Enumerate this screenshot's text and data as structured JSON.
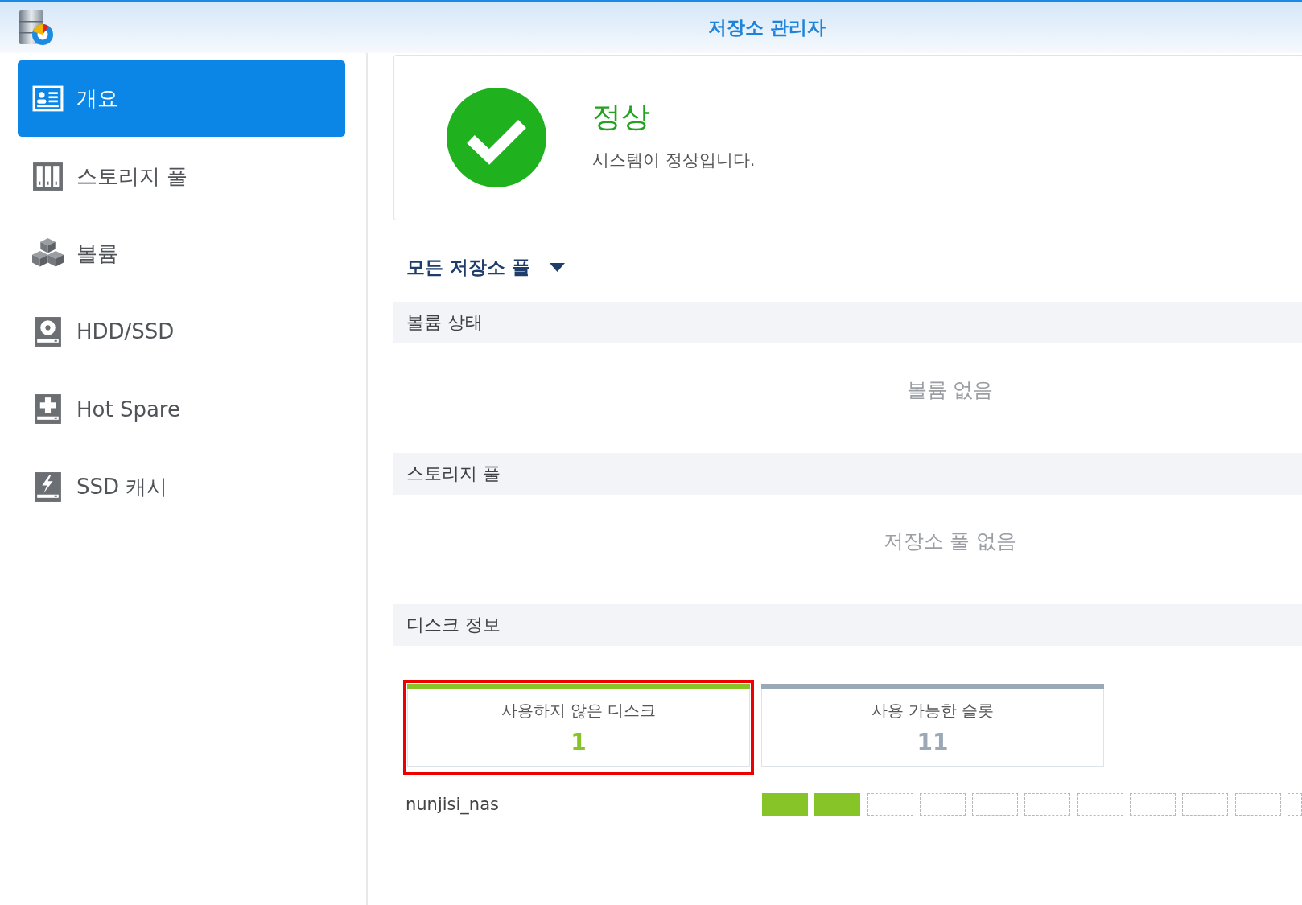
{
  "window": {
    "title": "저장소 관리자"
  },
  "sidebar": {
    "items": [
      {
        "label": "개요",
        "selected": true
      },
      {
        "label": "스토리지 풀",
        "selected": false
      },
      {
        "label": "볼륨",
        "selected": false
      },
      {
        "label": "HDD/SSD",
        "selected": false
      },
      {
        "label": "Hot Spare",
        "selected": false
      },
      {
        "label": "SSD 캐시",
        "selected": false
      }
    ]
  },
  "status": {
    "title": "정상",
    "message": "시스템이 정상입니다."
  },
  "pool_filter": {
    "value": "모든 저장소 풀"
  },
  "sections": [
    {
      "title": "볼륨 상태",
      "empty_text": "볼륨 없음"
    },
    {
      "title": "스토리지 풀",
      "empty_text": "저장소 풀 없음"
    }
  ],
  "disk_info": {
    "title": "디스크 정보",
    "cards": [
      {
        "label": "사용하지 않은 디스크",
        "value": "1",
        "color": "#86c427",
        "highlighted": true
      },
      {
        "label": "사용 가능한 슬롯",
        "value": "11",
        "color": "#9ba8b5",
        "highlighted": false
      }
    ],
    "hosts": [
      {
        "name": "nunjisi_nas",
        "slots": [
          {
            "filled": true
          },
          {
            "filled": true
          },
          {
            "filled": false
          },
          {
            "filled": false
          },
          {
            "filled": false
          },
          {
            "filled": false
          },
          {
            "filled": false
          },
          {
            "filled": false
          },
          {
            "filled": false
          },
          {
            "filled": false
          },
          {
            "filled": false
          }
        ]
      }
    ]
  }
}
